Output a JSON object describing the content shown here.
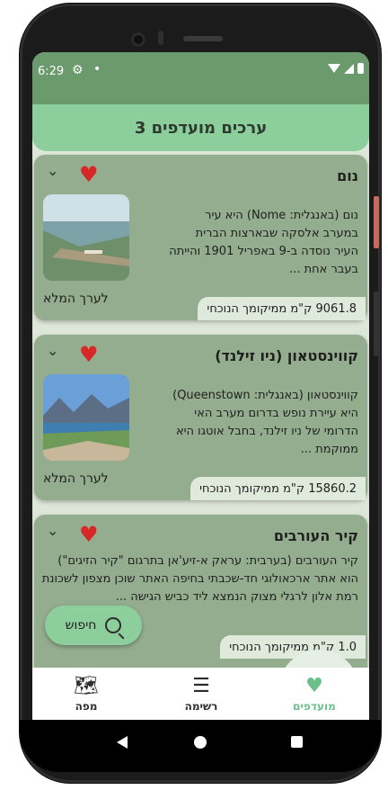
{
  "status_bar": {
    "time": "6:29"
  },
  "header": {
    "title": "3 ערכים מועדפים"
  },
  "cards": [
    {
      "title": "נום",
      "description": "נום (באנגלית: Nome) היא עיר במערב אלסקה שבארצות הברית  העיר נוסדה ב-9 באפריל 1901 והייתה בעבר אחת ...",
      "full_link": "לערך המלא",
      "distance": "9061.8 ק\"מ ממיקומך הנוכחי"
    },
    {
      "title": "קווינסטאון (ניו זילנד)",
      "description": "קווינסטאון (באנגלית: Queenstown) היא עיירת נופש בדרום מערב האי הדרומי של ניו זילנד, בחבל אוטגו  היא ממוקמת ...",
      "full_link": "לערך המלא",
      "distance": "15860.2 ק\"מ ממיקומך הנוכחי"
    },
    {
      "title": "קיר העורבים",
      "description": "קיר העורבים (בערבית: עראק א-זיע'אן בתרגום \"קיר הזיגים\") הוא אתר ארכאולוגי חד-שכבתי בחיפה  האתר שוכן מצפון לשכונת רמת אלון לרגלי מצוק הנמצא ליד כביש הגישה ...",
      "distance": "1.0 ק\"מ ממיקומך הנוכחי"
    }
  ],
  "search": {
    "label": "חיפוש"
  },
  "bottom_nav": {
    "map": "מפה",
    "list": "רשימה",
    "favorites": "מועדפים"
  },
  "colors": {
    "status_bar": "#6b9a6c",
    "header": "#8ccf9d",
    "card": "#94ad8e",
    "heart": "#d72828",
    "favorites_accent": "#6bbf8a"
  },
  "icons": {
    "heart": "heart-icon",
    "chevron": "chevron-down-icon",
    "search": "search-icon",
    "map": "map-icon",
    "list": "list-icon",
    "favorites": "heart-icon"
  }
}
